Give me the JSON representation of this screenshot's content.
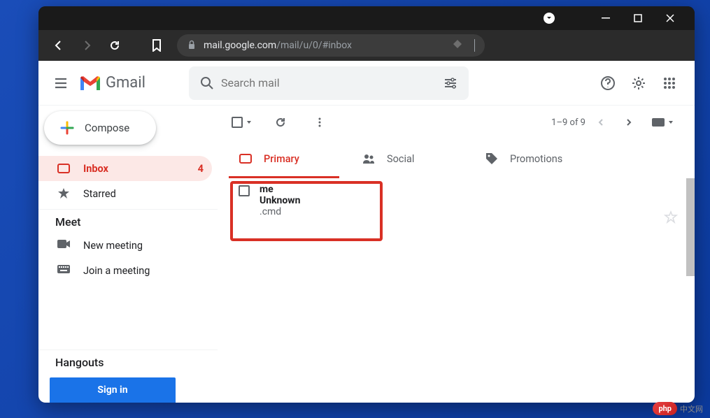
{
  "browser": {
    "url_domain": "mail.google.com",
    "url_path": "/mail/u/0/#inbox"
  },
  "header": {
    "logo_text": "Gmail",
    "search_placeholder": "Search mail"
  },
  "compose_label": "Compose",
  "sidebar": {
    "items": [
      {
        "label": "Inbox",
        "count": "4"
      },
      {
        "label": "Starred"
      }
    ],
    "meet_title": "Meet",
    "new_meeting": "New meeting",
    "join_meeting": "Join a meeting",
    "hangouts_title": "Hangouts",
    "signin": "Sign in"
  },
  "toolbar": {
    "pagination": "1–9 of 9"
  },
  "tabs": [
    {
      "label": "Primary"
    },
    {
      "label": "Social"
    },
    {
      "label": "Promotions"
    }
  ],
  "emails": [
    {
      "sender": "me",
      "subject": "Unknown",
      "snippet": ".cmd"
    }
  ],
  "watermark": {
    "badge": "php",
    "text": "中文网"
  }
}
